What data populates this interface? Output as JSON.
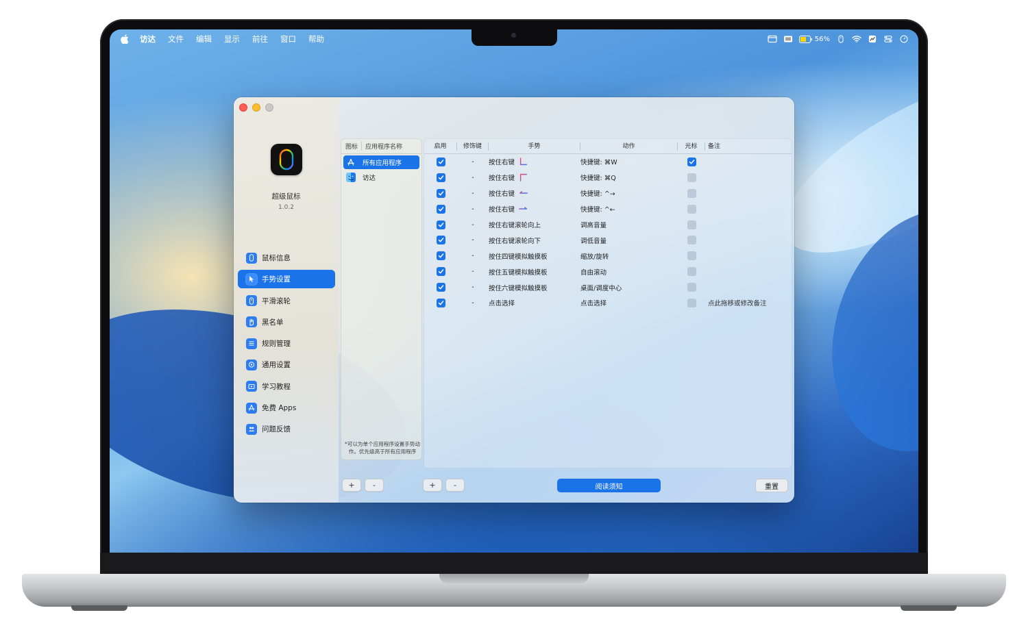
{
  "menubar": {
    "app": "访达",
    "items": [
      "文件",
      "编辑",
      "显示",
      "前往",
      "窗口",
      "帮助"
    ],
    "battery": "56%"
  },
  "app": {
    "name": "超级鼠标",
    "version": "1.0.2",
    "accent": "#1a73e8"
  },
  "sidebar": {
    "items": [
      {
        "label": "鼠标信息",
        "icon": "mouse-icon"
      },
      {
        "label": "手势设置",
        "icon": "pointer-icon",
        "active": true
      },
      {
        "label": "平滑滚轮",
        "icon": "scroll-icon"
      },
      {
        "label": "黑名单",
        "icon": "hand-icon"
      },
      {
        "label": "规则管理",
        "icon": "list-icon"
      },
      {
        "label": "通用设置",
        "icon": "gear-icon"
      },
      {
        "label": "学习教程",
        "icon": "play-icon"
      },
      {
        "label": "免费 Apps",
        "icon": "appstore-icon"
      },
      {
        "label": "问题反馈",
        "icon": "people-icon"
      }
    ]
  },
  "app_list": {
    "headers": {
      "icon": "图标",
      "name": "应用程序名称"
    },
    "rows": [
      {
        "name": "所有应用程序",
        "icon": "appstore-icon",
        "selected": true
      },
      {
        "name": "访达",
        "icon": "finder-icon",
        "selected": false
      }
    ],
    "note": "*可以为单个应用程序设置手势动作。优先级高于所有应用程序"
  },
  "rules_table": {
    "headers": {
      "enabled": "启用",
      "modifier": "修饰键",
      "gesture": "手势",
      "action": "动作",
      "cursor": "光标",
      "note": "备注"
    },
    "rows": [
      {
        "enabled": true,
        "modifier": "-",
        "gesture": "按住右键",
        "mark": "down-right-icon",
        "action": "快捷键: ⌘W",
        "cursor": true,
        "note": ""
      },
      {
        "enabled": true,
        "modifier": "-",
        "gesture": "按住右键",
        "mark": "up-right-icon",
        "action": "快捷键: ⌘Q",
        "cursor": false,
        "note": ""
      },
      {
        "enabled": true,
        "modifier": "-",
        "gesture": "按住右键",
        "mark": "left-arrow-icon",
        "action": "快捷键: ^→",
        "cursor": false,
        "note": ""
      },
      {
        "enabled": true,
        "modifier": "-",
        "gesture": "按住右键",
        "mark": "right-arrow-icon",
        "action": "快捷键: ^←",
        "cursor": false,
        "note": ""
      },
      {
        "enabled": true,
        "modifier": "-",
        "gesture": "按住右键滚轮向上",
        "mark": "",
        "action": "调高音量",
        "cursor": false,
        "note": ""
      },
      {
        "enabled": true,
        "modifier": "-",
        "gesture": "按住右键滚轮向下",
        "mark": "",
        "action": "调低音量",
        "cursor": false,
        "note": ""
      },
      {
        "enabled": true,
        "modifier": "-",
        "gesture": "按住四键模拟触摸板",
        "mark": "",
        "action": "缩放/旋转",
        "cursor": false,
        "note": ""
      },
      {
        "enabled": true,
        "modifier": "-",
        "gesture": "按住五键模拟触摸板",
        "mark": "",
        "action": "自由滚动",
        "cursor": false,
        "note": ""
      },
      {
        "enabled": true,
        "modifier": "-",
        "gesture": "按住六键模拟触摸板",
        "mark": "",
        "action": "桌面/调度中心",
        "cursor": false,
        "note": ""
      },
      {
        "enabled": true,
        "modifier": "-",
        "gesture": "点击选择",
        "mark": "",
        "action": "点击选择",
        "cursor": false,
        "note": "点此拖移或修改备注"
      }
    ]
  },
  "buttons": {
    "add": "+",
    "remove": "-",
    "read_notice": "阅读须知",
    "reset": "重置"
  }
}
